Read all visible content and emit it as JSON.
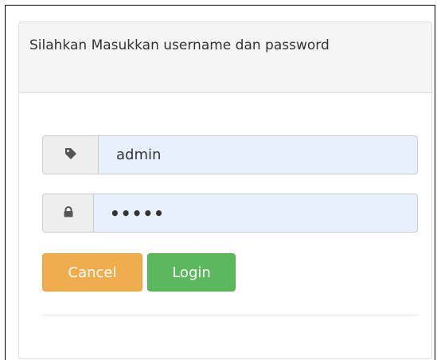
{
  "panel": {
    "heading": "Silahkan Masukkan username dan password"
  },
  "form": {
    "username": {
      "icon": "tag-icon",
      "value": "admin"
    },
    "password": {
      "icon": "lock-icon",
      "value": "•••••"
    },
    "cancel_label": "Cancel",
    "login_label": "Login"
  },
  "colors": {
    "cancel": "#f0ad4e",
    "login": "#5cb85c",
    "input_bg": "#e8f0fe",
    "heading_bg": "#f5f5f5"
  }
}
